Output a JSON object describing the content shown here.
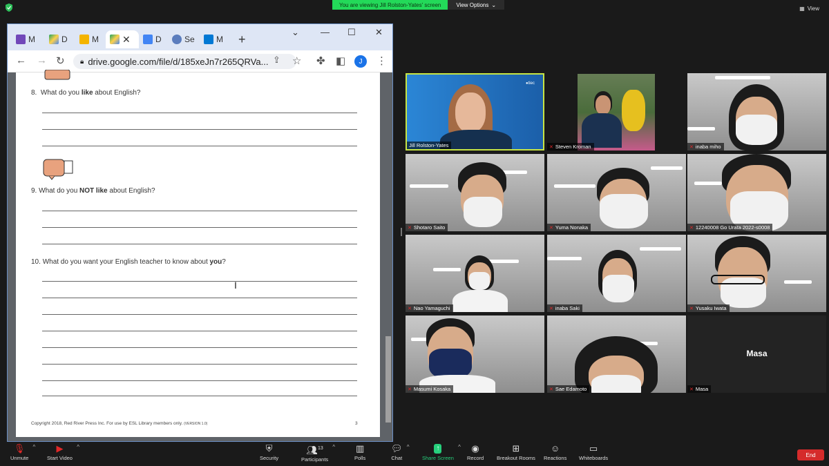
{
  "zoom": {
    "share_banner": "You are viewing Jill Rolston-Yates' screen",
    "view_options": "View Options",
    "view_label": "View"
  },
  "browser": {
    "tabs": [
      {
        "label": "M",
        "icon": "forms-icon",
        "color": "#7248b9"
      },
      {
        "label": "D",
        "icon": "drive-icon",
        "color": "#1fa463"
      },
      {
        "label": "M",
        "icon": "slides-icon",
        "color": "#f4b400"
      },
      {
        "label": "",
        "icon": "drive-icon",
        "color": "#1fa463",
        "active": true
      },
      {
        "label": "D",
        "icon": "docs-icon",
        "color": "#4285f4"
      },
      {
        "label": "Se",
        "icon": "settings-icon",
        "color": "#5b7dbd"
      },
      {
        "label": "M",
        "icon": "outlook-icon",
        "color": "#0078d4"
      }
    ],
    "url": "drive.google.com/file/d/185xeJn7r265QRVa...",
    "avatar_letter": "J"
  },
  "document": {
    "q8": {
      "num": "8.",
      "pre": "What do you ",
      "bold": "like",
      "post": " about English?"
    },
    "q9": {
      "num": "9.",
      "pre": "What do you ",
      "bold": "NOT like",
      "post": " about English?"
    },
    "q10": {
      "num": "10.",
      "pre": "What do you want your English teacher to know about ",
      "bold": "you",
      "post": "?"
    },
    "copyright": "Copyright 2018, Red River Press Inc. For use by ESL Library members only.",
    "version": "(VERSION 1.0)",
    "page_number": "3"
  },
  "participants": [
    {
      "name": "Jill Rolston-Yates",
      "muted": false
    },
    {
      "name": "Steven Kroman",
      "muted": true
    },
    {
      "name": "inaba miho",
      "muted": true
    },
    {
      "name": "Shotaro Saito",
      "muted": true
    },
    {
      "name": "Yuma Nonaka",
      "muted": true
    },
    {
      "name": "12240008 Go Urata 2022-s0008",
      "muted": true
    },
    {
      "name": "Nao Yamaguchi",
      "muted": true
    },
    {
      "name": "inaba Saki",
      "muted": true
    },
    {
      "name": "Yusaku Iwata",
      "muted": true
    },
    {
      "name": "Masumi Kosaka",
      "muted": true
    },
    {
      "name": "Sae Edamoto",
      "muted": true
    },
    {
      "name": "Masa",
      "muted": true
    }
  ],
  "masa_display": "Masa",
  "toolbar": {
    "unmute": "Unmute",
    "start_video": "Start Video",
    "security": "Security",
    "participants": "Participants",
    "participants_count": "13",
    "polls": "Polls",
    "chat": "Chat",
    "share_screen": "Share Screen",
    "record": "Record",
    "breakout_rooms": "Breakout Rooms",
    "reactions": "Reactions",
    "whiteboards": "Whiteboards",
    "end": "End"
  }
}
